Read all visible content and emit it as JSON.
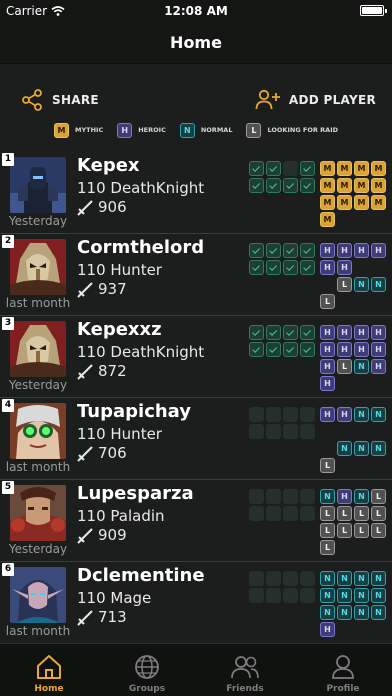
{
  "status": {
    "carrier": "Carrier",
    "time": "12:08 AM"
  },
  "nav": {
    "title": "Home"
  },
  "actions": {
    "share": "SHARE",
    "add_player": "ADD PLAYER"
  },
  "legend": [
    {
      "code": "M",
      "label": "MYTHIC",
      "tier": "m"
    },
    {
      "code": "H",
      "label": "HEROIC",
      "tier": "h"
    },
    {
      "code": "N",
      "label": "NORMAL",
      "tier": "n"
    },
    {
      "code": "L",
      "label": "LOOKING FOR RAID",
      "tier": "l"
    }
  ],
  "players": [
    {
      "rank": "1",
      "name": "Kepex",
      "level_class": "110 DeathKnight",
      "ilvl": "906",
      "last_seen": "Yesterday",
      "portrait": "armored-knight",
      "checks": [
        1,
        1,
        0,
        1,
        1,
        1,
        1,
        1
      ],
      "badges": [
        "M",
        "M",
        "M",
        "M",
        "M",
        "M",
        "M",
        "M",
        "M",
        "M",
        "M",
        "M",
        "M"
      ]
    },
    {
      "rank": "2",
      "name": "Cormthelord",
      "level_class": "110 Hunter",
      "ilvl": "937",
      "last_seen": "last month",
      "portrait": "masked-elf",
      "checks": [
        1,
        1,
        1,
        1,
        1,
        1,
        1,
        1
      ],
      "badges": [
        "H",
        "H",
        "H",
        "H",
        "H",
        "H",
        "",
        "",
        "",
        "L",
        "N",
        "N",
        "L"
      ]
    },
    {
      "rank": "3",
      "name": "Kepexxz",
      "level_class": "110 DeathKnight",
      "ilvl": "872",
      "last_seen": "Yesterday",
      "portrait": "masked-elf",
      "checks": [
        1,
        1,
        1,
        1,
        1,
        1,
        1,
        1
      ],
      "badges": [
        "H",
        "H",
        "H",
        "H",
        "H",
        "H",
        "H",
        "H",
        "H",
        "L",
        "N",
        "H",
        "H"
      ]
    },
    {
      "rank": "4",
      "name": "Tupapichay",
      "level_class": "110 Hunter",
      "ilvl": "706",
      "last_seen": "last month",
      "portrait": "goggles-gnome",
      "checks": [
        0,
        0,
        0,
        0,
        0,
        0,
        0,
        0
      ],
      "badges": [
        "H",
        "H",
        "N",
        "N",
        "",
        "",
        "",
        "",
        "",
        "N",
        "N",
        "N",
        "L"
      ]
    },
    {
      "rank": "5",
      "name": "Lupesparza",
      "level_class": "110 Paladin",
      "ilvl": "909",
      "last_seen": "Yesterday",
      "portrait": "red-warrior",
      "checks": [
        0,
        0,
        0,
        0,
        0,
        0,
        0,
        0
      ],
      "badges": [
        "N",
        "H",
        "N",
        "L",
        "L",
        "L",
        "L",
        "L",
        "L",
        "L",
        "L",
        "L",
        "L"
      ]
    },
    {
      "rank": "6",
      "name": "Dclementine",
      "level_class": "110 Mage",
      "ilvl": "713",
      "last_seen": "last month",
      "portrait": "blue-elf",
      "checks": [
        0,
        0,
        0,
        0,
        0,
        0,
        0,
        0
      ],
      "badges": [
        "N",
        "N",
        "N",
        "N",
        "N",
        "N",
        "N",
        "N",
        "N",
        "N",
        "N",
        "N",
        "H"
      ]
    }
  ],
  "tabs": [
    {
      "label": "Home",
      "icon": "home-icon",
      "active": true
    },
    {
      "label": "Groups",
      "icon": "globe-icon",
      "active": false
    },
    {
      "label": "Friends",
      "icon": "friends-icon",
      "active": false
    },
    {
      "label": "Profile",
      "icon": "profile-icon",
      "active": false
    }
  ],
  "colors": {
    "accent": "#e9a734",
    "background": "#1b1e1c",
    "check": "#44c6a4"
  }
}
